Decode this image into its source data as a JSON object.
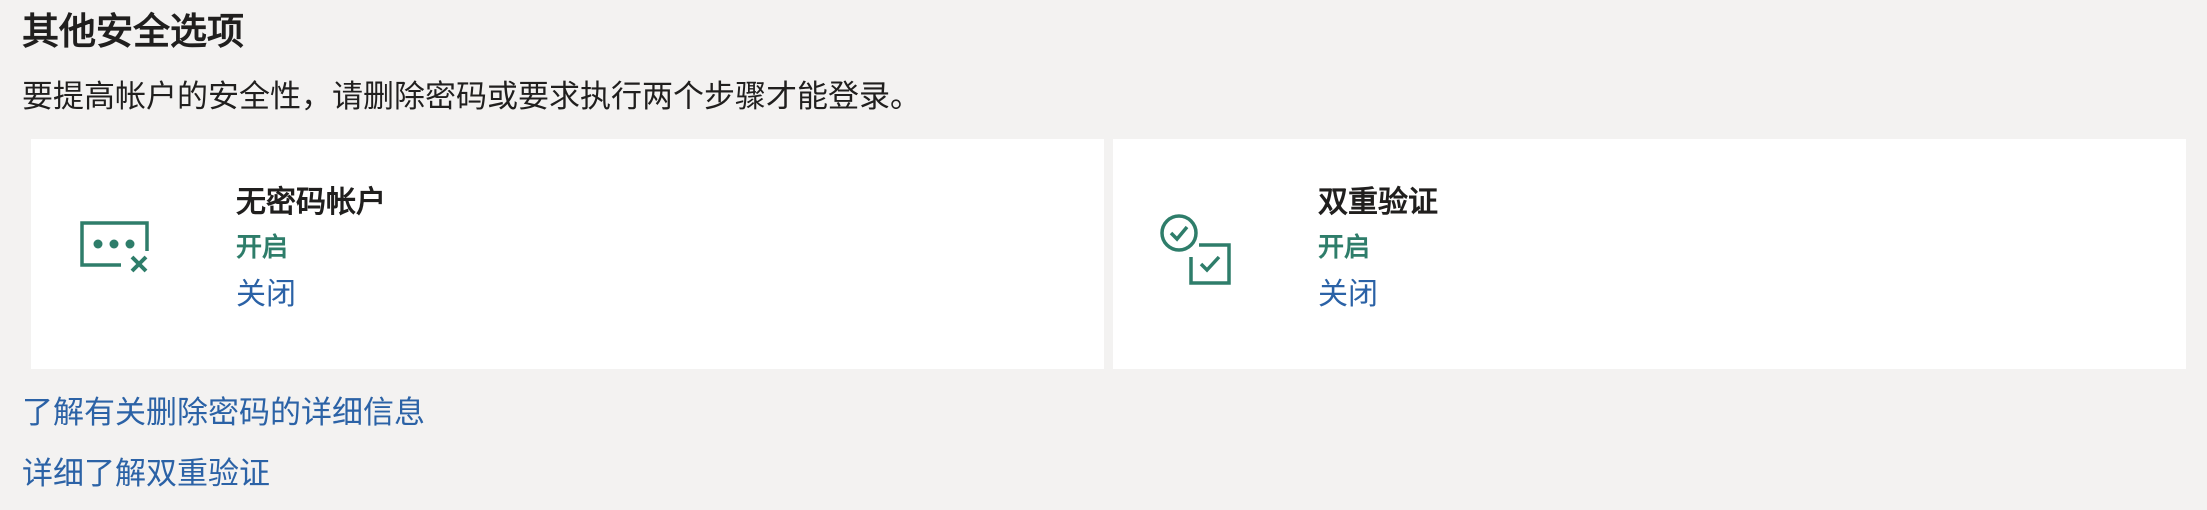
{
  "section": {
    "title": "其他安全选项",
    "description": "要提高帐户的安全性，请删除密码或要求执行两个步骤才能登录。"
  },
  "colors": {
    "background": "#f3f2f1",
    "card_background": "#ffffff",
    "accent_green": "#2e7d6a",
    "link_blue": "#2b62a6",
    "text": "#201f1e"
  },
  "cards": [
    {
      "icon": "password-dots-remove-icon",
      "title": "无密码帐户",
      "status": "开启",
      "action": "关闭"
    },
    {
      "icon": "two-step-checkbox-icon",
      "title": "双重验证",
      "status": "开启",
      "action": "关闭"
    }
  ],
  "links": {
    "learn_remove_password": "了解有关删除密码的详细信息",
    "learn_two_step": "详细了解双重验证"
  }
}
